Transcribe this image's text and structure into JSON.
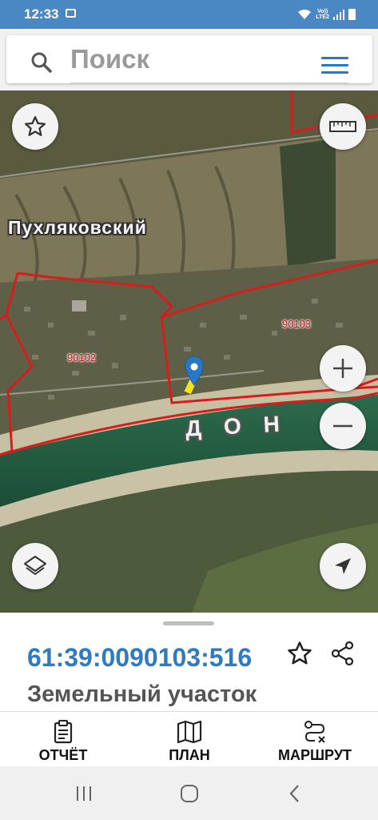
{
  "status_bar": {
    "time": "12:33",
    "network_top": "Vo))",
    "network_bottom": "LTE2"
  },
  "search": {
    "placeholder": "Поиск"
  },
  "map": {
    "place_name": "Пухляковский",
    "quarter_labels": [
      "90102",
      "90103"
    ],
    "river_name": "ДОН",
    "buttons": [
      "favorites",
      "ruler",
      "zoom-in",
      "zoom-out",
      "layers",
      "my-location"
    ]
  },
  "parcel": {
    "cadastral_number": "61:39:0090103:516",
    "object_type": "Земельный участок"
  },
  "bottom_nav": {
    "report_label": "ОТЧЁТ",
    "plan_label": "ПЛАН",
    "route_label": "МАРШРУТ"
  },
  "colors": {
    "accent": "#2f7bbd",
    "status_bar": "#4a88c4",
    "boundary": "#d81c1c",
    "river": "#1f5b3f"
  }
}
